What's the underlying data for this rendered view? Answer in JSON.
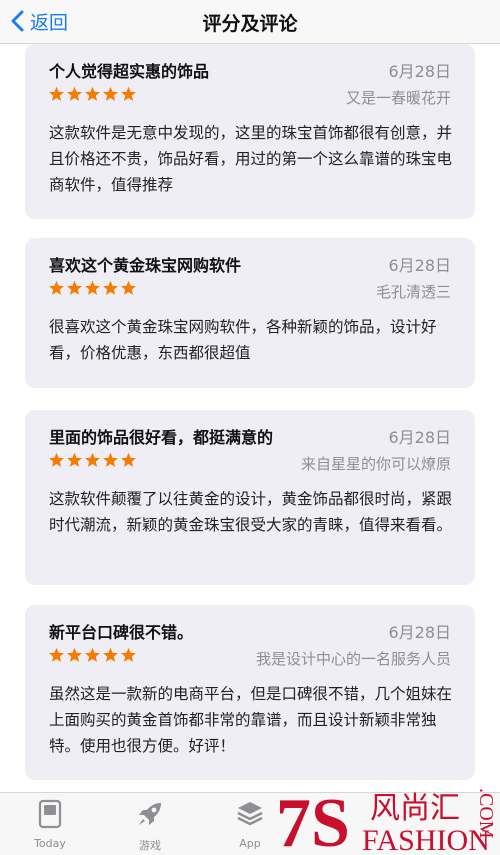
{
  "nav": {
    "back_label": "返回",
    "title": "评分及评论"
  },
  "colors": {
    "accent": "#1a7cf5",
    "star": "#f57c00",
    "card_bg": "#eeeef4",
    "muted": "#8e8e93",
    "watermark_red": "#c8102e"
  },
  "reviews": [
    {
      "title": "个人觉得超实惠的饰品",
      "date": "6月28日",
      "stars": 5,
      "author": "又是一春暖花开",
      "body": "这款软件是无意中发现的，这里的珠宝首饰都很有创意，并且价格还不贵，饰品好看，用过的第一个这么靠谱的珠宝电商软件，值得推荐"
    },
    {
      "title": "喜欢这个黄金珠宝网购软件",
      "date": "6月28日",
      "stars": 5,
      "author": "毛孔清透三",
      "body": "很喜欢这个黄金珠宝网购软件，各种新颖的饰品，设计好看，价格优惠，东西都很超值"
    },
    {
      "title": "里面的饰品很好看，都挺满意的",
      "date": "6月28日",
      "stars": 5,
      "author": "来自星星的你可以燎原",
      "body": "这款软件颠覆了以往黄金的设计，黄金饰品都很时尚，紧跟时代潮流，新颖的黄金珠宝很受大家的青睐，值得来看看。"
    },
    {
      "title": "新平台口碑很不错。",
      "date": "6月28日",
      "stars": 5,
      "author": "我是设计中心的一名服务人员",
      "body": "虽然这是一款新的电商平台，但是口碑很不错，几个姐妹在上面购买的黄金首饰都非常的靠谱，而且设计新颖非常独特。使用也很方便。好评！"
    }
  ],
  "tabs": [
    {
      "label": "Today",
      "icon": "today-icon"
    },
    {
      "label": "游戏",
      "icon": "rocket-icon"
    },
    {
      "label": "App",
      "icon": "layers-icon"
    }
  ],
  "watermark": {
    "mark": "7S",
    "cn": "风尚汇",
    "en": "FASHION",
    "domain": ".COM"
  }
}
